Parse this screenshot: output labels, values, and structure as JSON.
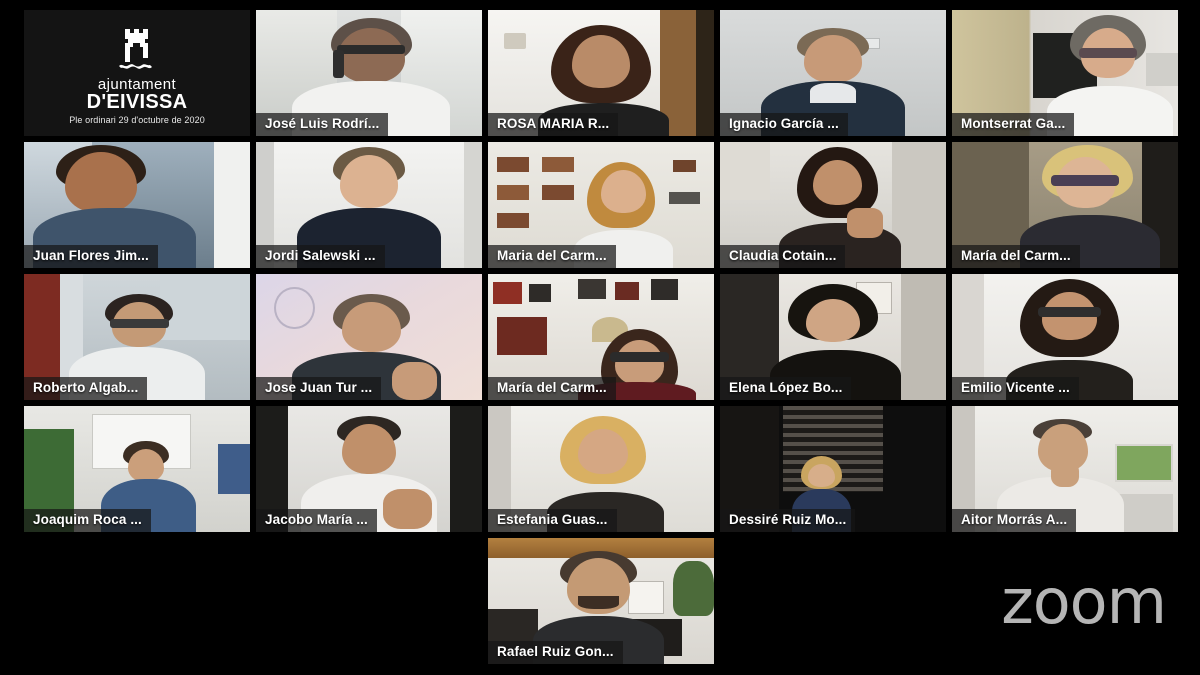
{
  "app": {
    "name": "Zoom",
    "view": "gallery-view",
    "watermark": "zoom",
    "background_color": "#000000",
    "active_speaker_color": "#4fe33f"
  },
  "logo_tile": {
    "icon": "castle-crest-icon",
    "line1": "ajuntament",
    "line2": "D'EIVISSA",
    "subtitle": "Ple ordinari 29 d'octubre de 2020"
  },
  "grid": {
    "columns": 5,
    "rows": 5,
    "total_tiles": 21,
    "rows_data": [
      [
        {
          "type": "logo",
          "name": "",
          "active": false
        },
        {
          "type": "video",
          "name": "José Luis Rodrí...",
          "active": false
        },
        {
          "type": "video",
          "name": "ROSA MARIA R...",
          "active": true
        },
        {
          "type": "video",
          "name": "Ignacio García ...",
          "active": false
        },
        {
          "type": "video",
          "name": "Montserrat Ga...",
          "active": false
        }
      ],
      [
        {
          "type": "video",
          "name": "Juan Flores Jim...",
          "active": false
        },
        {
          "type": "video",
          "name": "Jordi Salewski ...",
          "active": false
        },
        {
          "type": "video",
          "name": "Maria del Carm...",
          "active": false
        },
        {
          "type": "video",
          "name": "Claudia Cotain...",
          "active": false
        },
        {
          "type": "video",
          "name": "María del Carm...",
          "active": false
        }
      ],
      [
        {
          "type": "video",
          "name": "Roberto Algab...",
          "active": false
        },
        {
          "type": "video",
          "name": "Jose Juan Tur ...",
          "active": false
        },
        {
          "type": "video",
          "name": "María del Carm...",
          "active": false
        },
        {
          "type": "video",
          "name": "Elena López Bo...",
          "active": false
        },
        {
          "type": "video",
          "name": "Emilio Vicente ...",
          "active": false
        }
      ],
      [
        {
          "type": "video",
          "name": "Joaquim Roca ...",
          "active": false
        },
        {
          "type": "video",
          "name": "Jacobo María ...",
          "active": false
        },
        {
          "type": "video",
          "name": "Estefania Guas...",
          "active": false
        },
        {
          "type": "video",
          "name": "Dessiré Ruiz Mo...",
          "active": false
        },
        {
          "type": "video",
          "name": "Aitor Morrás A...",
          "active": false
        }
      ],
      [
        {
          "type": "video",
          "name": "Rafael Ruiz Gon...",
          "active": false
        }
      ]
    ]
  }
}
